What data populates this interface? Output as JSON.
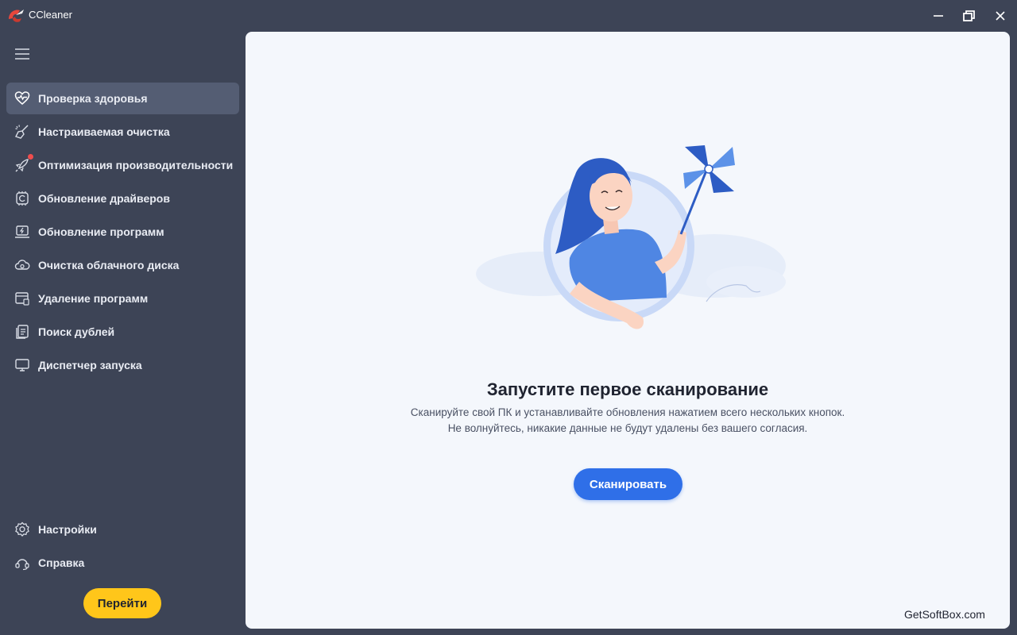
{
  "app": {
    "title": "CCleaner"
  },
  "sidebar": {
    "items": [
      {
        "label": "Проверка здоровья",
        "icon": "heart-pulse-icon",
        "active": true
      },
      {
        "label": "Настраиваемая очистка",
        "icon": "broom-icon"
      },
      {
        "label": "Оптимизация производительности",
        "icon": "rocket-icon",
        "badge": true
      },
      {
        "label": "Обновление драйверов",
        "icon": "driver-chip-icon"
      },
      {
        "label": "Обновление программ",
        "icon": "software-update-icon"
      },
      {
        "label": "Очистка облачного диска",
        "icon": "cloud-icon"
      },
      {
        "label": "Удаление программ",
        "icon": "uninstall-icon"
      },
      {
        "label": "Поиск дублей",
        "icon": "duplicates-icon"
      },
      {
        "label": "Диспетчер запуска",
        "icon": "monitor-icon"
      }
    ],
    "bottom_items": [
      {
        "label": "Настройки",
        "icon": "gear-icon"
      },
      {
        "label": "Справка",
        "icon": "help-icon"
      }
    ],
    "go_button": "Перейти"
  },
  "main": {
    "title": "Запустите первое сканирование",
    "desc_line1": "Сканируйте свой ПК и устанавливайте обновления нажатием всего нескольких кнопок.",
    "desc_line2": "Не волнуйтесь, никакие данные не будут удалены без вашего согласия.",
    "scan_button": "Сканировать"
  },
  "watermark": "GetSoftBox.com",
  "colors": {
    "sidebar_bg": "#3d4456",
    "active_item": "#545d73",
    "accent_blue": "#2f6fe8",
    "go_yellow": "#ffc61a",
    "badge_red": "#ef4d4d"
  }
}
